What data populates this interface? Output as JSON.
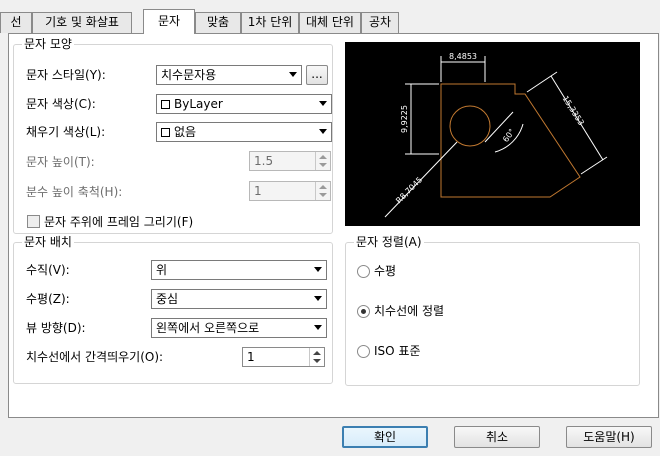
{
  "tabs": [
    "선",
    "기호 및 화살표",
    "문자",
    "맞춤",
    "1차 단위",
    "대체 단위",
    "공차"
  ],
  "text_appearance": {
    "title": "문자 모양",
    "style_label": "문자 스타일(Y):",
    "style_value": "치수문자용",
    "style_browse": "...",
    "color_label": "문자 색상(C):",
    "color_value": "ByLayer",
    "fill_label": "채우기 색상(L):",
    "fill_value": "없음",
    "height_label": "문자 높이(T):",
    "height_value": "1.5",
    "fraction_label": "분수 높이 축척(H):",
    "fraction_value": "1",
    "frame_label": "문자 주위에 프레임 그리기(F)"
  },
  "text_placement": {
    "title": "문자 배치",
    "vertical_label": "수직(V):",
    "vertical_value": "위",
    "horizontal_label": "수평(Z):",
    "horizontal_value": "중심",
    "view_label": "뷰 방향(D):",
    "view_value": "왼쪽에서 오른쪽으로",
    "offset_label": "치수선에서 간격띄우기(O):",
    "offset_value": "1"
  },
  "text_alignment": {
    "title": "문자 정렬(A)",
    "options": [
      "수평",
      "치수선에 정렬",
      "ISO 표준"
    ],
    "selected": 1
  },
  "preview": {
    "dim_top": "8,4853",
    "dim_left": "9,9225",
    "dim_right": "15,3353",
    "dim_diag": "R8,7045",
    "dim_angle": "60°",
    "line_color": "#ffffff",
    "object_color": "#c07830"
  },
  "buttons": {
    "ok": "확인",
    "cancel": "취소",
    "help": "도움말(H)"
  }
}
